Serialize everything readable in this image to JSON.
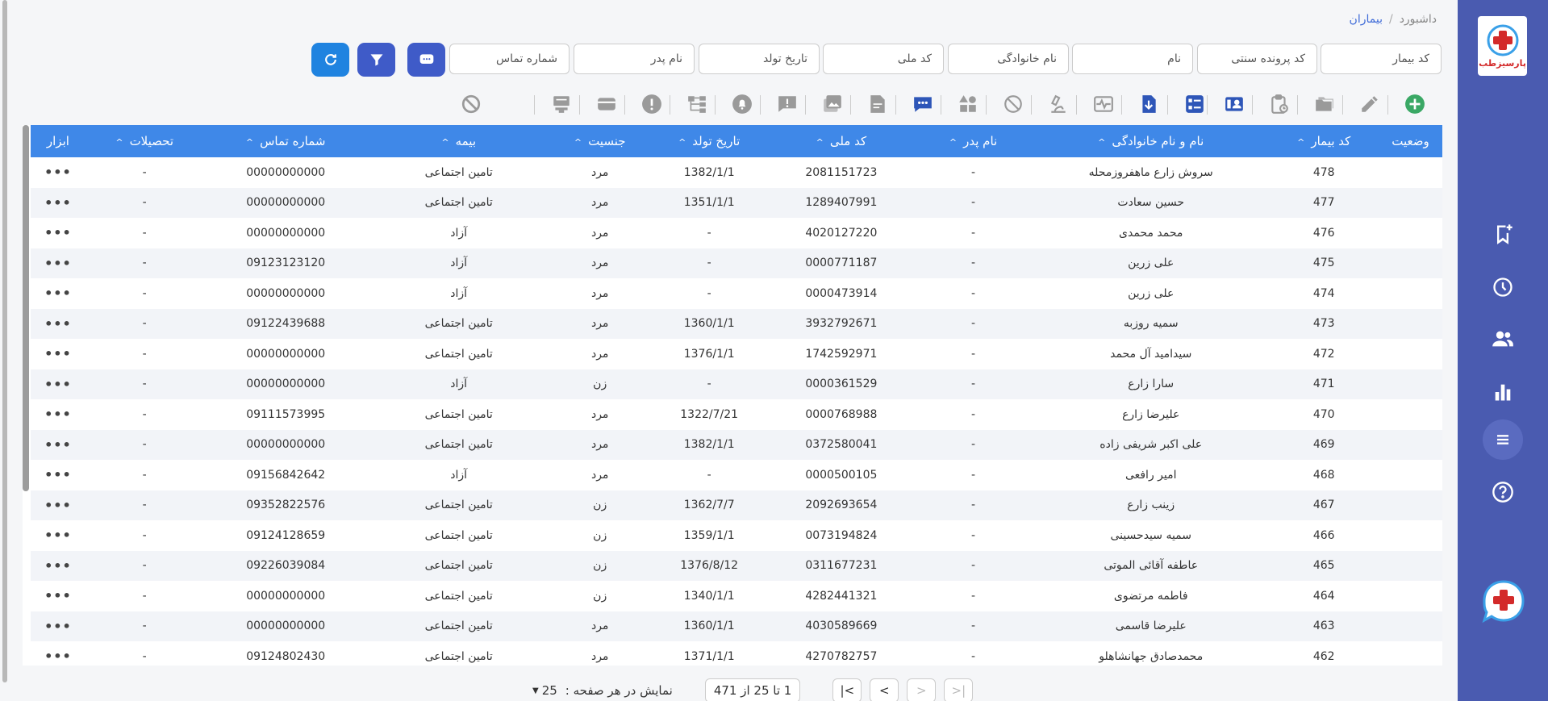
{
  "app": {
    "logo_text": "پارسیزطب"
  },
  "breadcrumb": {
    "home": "داشبورد",
    "separator": "/",
    "current": "بیماران"
  },
  "filters": {
    "patient_code": "کد بیمار",
    "traditional_file_code": "کد پرونده سنتی",
    "first_name": "نام",
    "last_name": "نام خانوادگی",
    "national_code": "کد ملی",
    "birth_date": "تاریخ تولد",
    "father_name": "نام پدر",
    "phone": "شماره تماس"
  },
  "colors": {
    "sidebar": "#4a5bb0",
    "header": "#3f88e8",
    "btn_primary": "#3f5bc8",
    "btn_refresh": "#1f83e0",
    "add_green": "#3aa865"
  },
  "table": {
    "headers": {
      "status": "وضعیت",
      "patient_code": "کد بیمار",
      "full_name": "نام و نام خانوادگی",
      "father_name": "نام پدر",
      "national_code": "کد ملی",
      "birth_date": "تاریخ تولد",
      "gender": "جنسیت",
      "insurance": "بیمه",
      "phone": "شماره تماس",
      "education": "تحصیلات",
      "tools": "ابزار"
    },
    "rows": [
      {
        "code": "478",
        "name": "سروش زارع ماهفروزمحله",
        "father": "-",
        "national": "2081151723",
        "birth": "1382/1/1",
        "gender": "مرد",
        "insurance": "تامین اجتماعی",
        "phone": "00000000000",
        "edu": "-"
      },
      {
        "code": "477",
        "name": "حسین سعادت",
        "father": "-",
        "national": "1289407991",
        "birth": "1351/1/1",
        "gender": "مرد",
        "insurance": "تامین اجتماعی",
        "phone": "00000000000",
        "edu": "-"
      },
      {
        "code": "476",
        "name": "محمد محمدی",
        "father": "-",
        "national": "4020127220",
        "birth": "-",
        "gender": "مرد",
        "insurance": "آزاد",
        "phone": "00000000000",
        "edu": "-"
      },
      {
        "code": "475",
        "name": "علی زرین",
        "father": "-",
        "national": "0000771187",
        "birth": "-",
        "gender": "مرد",
        "insurance": "آزاد",
        "phone": "09123123120",
        "edu": "-"
      },
      {
        "code": "474",
        "name": "علی زرین",
        "father": "-",
        "national": "0000473914",
        "birth": "-",
        "gender": "مرد",
        "insurance": "آزاد",
        "phone": "00000000000",
        "edu": "-"
      },
      {
        "code": "473",
        "name": "سمیه روزبه",
        "father": "-",
        "national": "3932792671",
        "birth": "1360/1/1",
        "gender": "مرد",
        "insurance": "تامین اجتماعی",
        "phone": "09122439688",
        "edu": "-"
      },
      {
        "code": "472",
        "name": "سیدامید آل محمد",
        "father": "-",
        "national": "1742592971",
        "birth": "1376/1/1",
        "gender": "مرد",
        "insurance": "تامین اجتماعی",
        "phone": "00000000000",
        "edu": "-"
      },
      {
        "code": "471",
        "name": "سارا زارع",
        "father": "-",
        "national": "0000361529",
        "birth": "-",
        "gender": "زن",
        "insurance": "آزاد",
        "phone": "00000000000",
        "edu": "-"
      },
      {
        "code": "470",
        "name": "علیرضا زارع",
        "father": "-",
        "national": "0000768988",
        "birth": "1322/7/21",
        "gender": "مرد",
        "insurance": "تامین اجتماعی",
        "phone": "09111573995",
        "edu": "-"
      },
      {
        "code": "469",
        "name": "علی اکبر شریفی زاده",
        "father": "-",
        "national": "0372580041",
        "birth": "1382/1/1",
        "gender": "مرد",
        "insurance": "تامین اجتماعی",
        "phone": "00000000000",
        "edu": "-"
      },
      {
        "code": "468",
        "name": "امیر رافعی",
        "father": "-",
        "national": "0000500105",
        "birth": "-",
        "gender": "مرد",
        "insurance": "آزاد",
        "phone": "09156842642",
        "edu": "-"
      },
      {
        "code": "467",
        "name": "زینب زارع",
        "father": "-",
        "national": "2092693654",
        "birth": "1362/7/7",
        "gender": "زن",
        "insurance": "تامین اجتماعی",
        "phone": "09352822576",
        "edu": "-"
      },
      {
        "code": "466",
        "name": "سمیه سیدحسینی",
        "father": "-",
        "national": "0073194824",
        "birth": "1359/1/1",
        "gender": "زن",
        "insurance": "تامین اجتماعی",
        "phone": "09124128659",
        "edu": "-"
      },
      {
        "code": "465",
        "name": "عاطفه آقائی الموتی",
        "father": "-",
        "national": "0311677231",
        "birth": "1376/8/12",
        "gender": "زن",
        "insurance": "تامین اجتماعی",
        "phone": "09226039084",
        "edu": "-"
      },
      {
        "code": "464",
        "name": "فاطمه مرتضوی",
        "father": "-",
        "national": "4282441321",
        "birth": "1340/1/1",
        "gender": "زن",
        "insurance": "تامین اجتماعی",
        "phone": "00000000000",
        "edu": "-"
      },
      {
        "code": "463",
        "name": "علیرضا قاسمی",
        "father": "-",
        "national": "4030589669",
        "birth": "1360/1/1",
        "gender": "مرد",
        "insurance": "تامین اجتماعی",
        "phone": "00000000000",
        "edu": "-"
      },
      {
        "code": "462",
        "name": "محمدصادق جهانشاهلو",
        "father": "-",
        "national": "4270782757",
        "birth": "1371/1/1",
        "gender": "مرد",
        "insurance": "تامین اجتماعی",
        "phone": "09124802430",
        "edu": "-"
      }
    ],
    "row_actions_label": "•••"
  },
  "pagination": {
    "per_page_label": "نمایش در هر صفحه :",
    "per_page_value": "25",
    "range": "1 تا 25 از 471",
    "first": "|<",
    "prev": "<",
    "next": ">",
    "last": ">|"
  }
}
